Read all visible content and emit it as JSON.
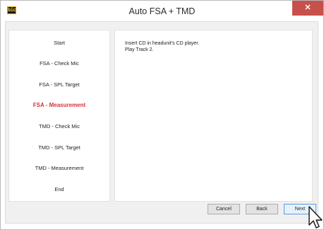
{
  "window": {
    "title": "Auto FSA + TMD",
    "app_icon_text": "bic",
    "close_glyph": "✕"
  },
  "steps": [
    {
      "label": "Start",
      "active": false
    },
    {
      "label": "FSA - Check Mic",
      "active": false
    },
    {
      "label": "FSA - SPL Target",
      "active": false
    },
    {
      "label": "FSA - Measurement",
      "active": true
    },
    {
      "label": "TMD - Check Mic",
      "active": false
    },
    {
      "label": "TMD - SPL Target",
      "active": false
    },
    {
      "label": "TMD - Measurement",
      "active": false
    },
    {
      "label": "End",
      "active": false
    }
  ],
  "content": {
    "line1": "Insert CD in headunit's CD player.",
    "line2": "Play Track 2."
  },
  "buttons": {
    "cancel": "Cancel",
    "back": "Back",
    "next": "Next"
  },
  "colors": {
    "active_step": "#d33535",
    "close_button": "#c7504b"
  },
  "icons": {
    "app": "bic-logo-icon",
    "close": "close-icon",
    "cursor": "mouse-pointer-icon"
  }
}
